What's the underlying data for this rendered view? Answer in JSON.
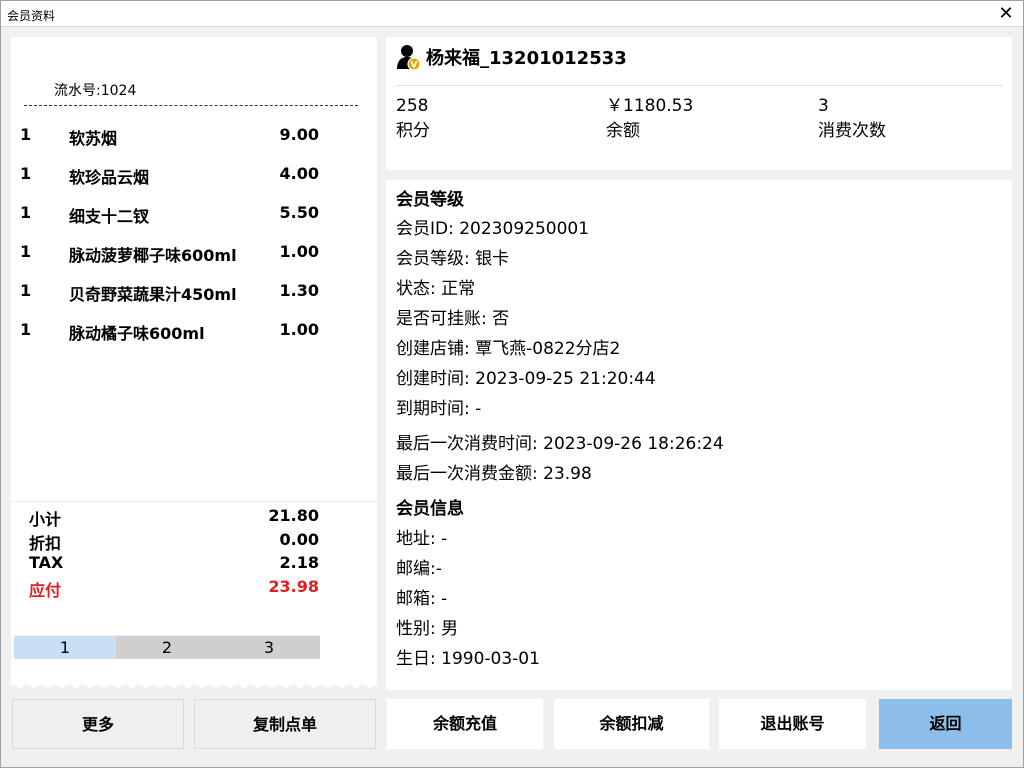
{
  "window": {
    "title": "会员资料"
  },
  "receipt": {
    "serial": "流水号:1024",
    "items": [
      {
        "qty": "1",
        "name": "软苏烟",
        "price": "9.00"
      },
      {
        "qty": "1",
        "name": "软珍品云烟",
        "price": "4.00"
      },
      {
        "qty": "1",
        "name": "细支十二钗",
        "price": "5.50"
      },
      {
        "qty": "1",
        "name": "脉动菠萝椰子味600ml",
        "price": "1.00"
      },
      {
        "qty": "1",
        "name": "贝奇野菜蔬果汁450ml",
        "price": "1.30"
      },
      {
        "qty": "1",
        "name": "脉动橘子味600ml",
        "price": "1.00"
      }
    ],
    "subtotal_label": "小计",
    "subtotal": "21.80",
    "discount_label": "折扣",
    "discount": "0.00",
    "tax_label": "TAX",
    "tax": "2.18",
    "payable_label": "应付",
    "payable": "23.98",
    "pages": [
      "1",
      "2",
      "3"
    ],
    "active_page": "1"
  },
  "member": {
    "name": "杨来福_13201012533",
    "points": "258",
    "points_label": "积分",
    "balance": "￥1180.53",
    "balance_label": "余额",
    "visits": "3",
    "visits_label": "消费次数",
    "level_heading": "会员等级",
    "id_line": "会员ID: 202309250001",
    "level_line": "会员等级: 银卡",
    "status_line": "状态: 正常",
    "credit_line": "是否可挂账: 否",
    "store_line": "创建店铺: 覃飞燕-0822分店2",
    "created_line": "创建时间: 2023-09-25 21:20:44",
    "expire_line": "到期时间: -",
    "last_time_line": "最后一次消费时间: 2023-09-26 18:26:24",
    "last_amount_line": "最后一次消费金额: 23.98",
    "info_heading": "会员信息",
    "address_line": "地址: -",
    "zip_line": "邮编:-",
    "email_line": "邮箱: -",
    "gender_line": "性别: 男",
    "birthday_line": "生日: 1990-03-01"
  },
  "buttons": {
    "more": "更多",
    "copy_order": "复制点单",
    "recharge": "余额充值",
    "deduct": "余额扣减",
    "logout": "退出账号",
    "back": "返回"
  },
  "colors": {
    "payable": "#e02020",
    "back_button": "#8dbde9",
    "active_page": "#c7e0f4",
    "vip_badge": "#e0a800"
  },
  "icons": {
    "close": "close-icon",
    "user": "vip-user-icon"
  }
}
